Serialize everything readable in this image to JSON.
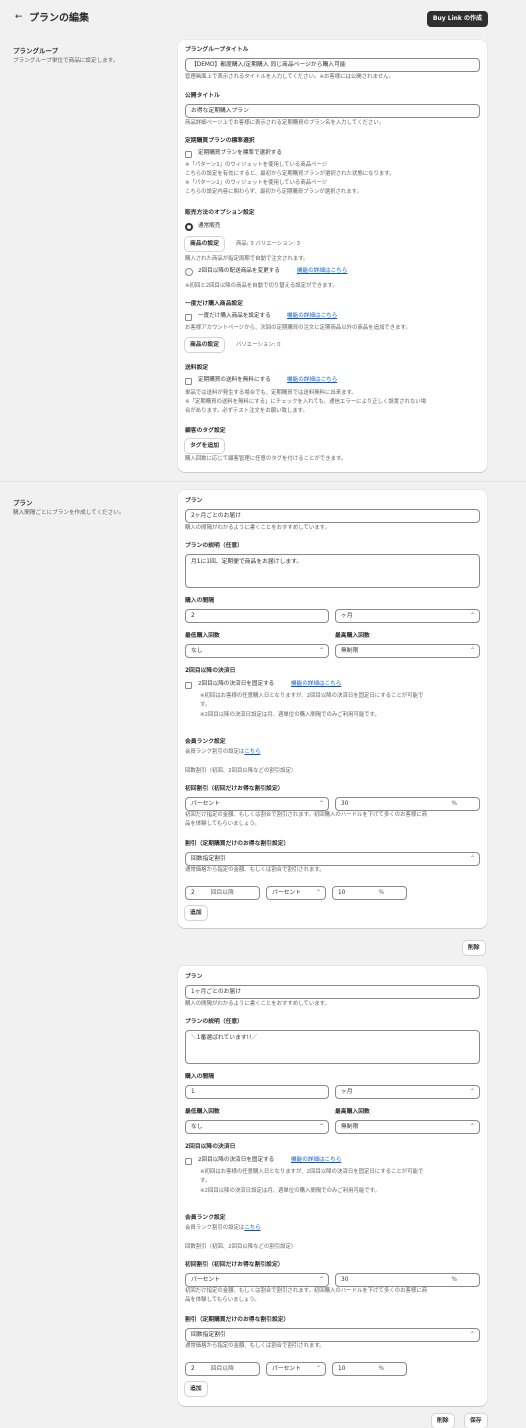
{
  "header": {
    "back_glyph": "←",
    "title": "プランの編集",
    "buy_link_button": "Buy Link の作成"
  },
  "plan_group_section": {
    "heading": "プラングループ",
    "description": "プラングループ単位で商品に設定します。"
  },
  "plan_group_card": {
    "title_label": "プラングループタイトル",
    "title_value": "【DEMO】都度購入/定期購入 同じ商品ページから購入可能",
    "title_help": "管理画面上で表示されるタイトルを入力してください。※お客様には公開されません。",
    "public_title_label": "公開タイトル",
    "public_title_value": "お得な定期購入プラン",
    "public_title_help": "商品詳細ページ上でお客様に表示される定期購買のプラン名を入力してください。",
    "default_select_label": "定期購買プランの標準選択",
    "default_select_checkbox": "定期購買プランを標準で選択する",
    "default_notes": [
      "※「パターン1」のウィジェットを使用している商品ページ",
      "こちらの設定を有効にすると、最初から定期購買プランが選択された状態になります。",
      "※「パターン2」のウィジェットを使用している商品ページ",
      "こちらの設定内容に関わらず、最初から定期購買プランが選択されます。"
    ],
    "sales_option_label": "販売方法のオプション設定",
    "normal_sale_radio": "通常販売",
    "product_setting_button": "商品の設定",
    "product_summary": "商品: 3 バリエーション: 3",
    "product_help": "購入された商品が指定周期で自動で注文されます。",
    "change_product_radio": "2回目以降の配送商品を変更する",
    "feature_link": "機能の詳細はこちら",
    "change_product_help": "※初回と2回目以降の商品を自動で切り替える設定ができます。",
    "one_time_label": "一度だけ購入商品設定",
    "one_time_checkbox": "一度だけ購入商品を設定する",
    "one_time_help": "お客様アカウントページから、次回の定期購買の注文に定期商品以外の商品を追加できます。",
    "one_time_product_button": "商品の設定",
    "one_time_variation": "バリエーション: 0",
    "shipping_label": "送料設定",
    "shipping_checkbox": "定期購買の送料を無料にする",
    "shipping_notes": [
      "単品では送料が発生する場合でも、定期購買では送料無料に出来ます。",
      "※「定期購買の送料を無料にする」にチェックを入れても、通信エラーにより正しく設置されない場",
      "合があります。必ずテスト注文をお願い致します。"
    ],
    "customer_tag_label": "顧客のタグ設定",
    "add_tag_button": "タグを追加",
    "customer_tag_help": "購入回数に応じて顧客管理に任意のタグを付けることができます。"
  },
  "plan_section": {
    "heading": "プラン",
    "description": "購入間隔ごとにプランを作成してください。"
  },
  "common": {
    "plan_label": "プラン",
    "plan_help": "購入の間隔がわかるように書くことをおすすめしています。",
    "desc_label": "プランの説明（任意）",
    "interval_label": "購入の間隔",
    "min_label": "最低購入回数",
    "max_label": "最高購入回数",
    "payment_date_label": "2回目以降の決済日",
    "payment_checkbox": "2回目以降の決済日を固定する",
    "feature_link": "機能の詳細はこちら",
    "payment_notes": [
      "※初回はお客様の任意購入日となりますが、2回目以降の決済日を固定日にすることが可能で",
      "す。",
      "※2回目以降の決済日設定は月、週単位の購入間隔でのみご利用可能です。"
    ],
    "rank_label": "会員ランク設定",
    "rank_text": "会員ランク割引の設定は",
    "rank_link": "こちら",
    "count_discount": "回数割引（初回、2回目以降などの割引設定）",
    "first_discount_label": "初回割引（初回だけお得な割引設定）",
    "first_discount_help": [
      "初回だけ指定の金額、もしくは割合で割引されます。初回購入のハードルを下げて多くのお客様に商",
      "品を体験してもらいましょう。"
    ],
    "discount_label": "割引（定期購買だけのお得な割引設定）",
    "discount_help": "通常価格から指定の金額、もしくは割合で割引されます。",
    "add_button": "追加"
  },
  "plans": [
    {
      "plan_value": "2ヶ月ごとのお届け",
      "desc_value": "月1に1回、定期便で商品をお届けします。",
      "interval_value": "2",
      "interval_unit": "ヶ月",
      "min_value": "なし",
      "max_value": "無制限",
      "first_type": "パーセント",
      "first_value": "30",
      "percent_sign": "%",
      "discount_type": "回数指定割引",
      "row_count": "2",
      "row_from": "回目以降",
      "row_type": "パーセント",
      "row_value": "10",
      "row_sign": "%"
    },
    {
      "plan_value": "1ヶ月ごとのお届け",
      "desc_value": "＼1番選ばれています!!／",
      "interval_value": "1",
      "interval_unit": "ヶ月",
      "min_value": "なし",
      "max_value": "無制限",
      "first_type": "パーセント",
      "first_value": "30",
      "percent_sign": "%",
      "discount_type": "回数指定割引",
      "row_count": "2",
      "row_from": "回目以降",
      "row_type": "パーセント",
      "row_value": "10",
      "row_sign": "%"
    }
  ],
  "delete_button": "削除",
  "footer": {
    "delete": "削除",
    "save": "保存"
  }
}
